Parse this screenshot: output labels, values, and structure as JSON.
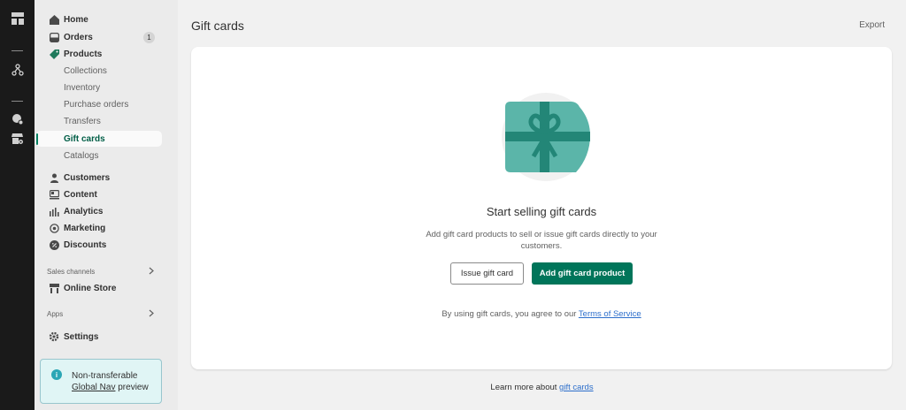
{
  "rail": {
    "icons": [
      "layout-icon",
      "branch-icon",
      "globe-gear-icon",
      "store-gear-icon"
    ]
  },
  "sidebar": {
    "items": [
      {
        "label": "Home",
        "icon": "home-icon"
      },
      {
        "label": "Orders",
        "icon": "orders-icon",
        "badge": "1"
      },
      {
        "label": "Products",
        "icon": "tag-icon"
      }
    ],
    "product_subitems": [
      "Collections",
      "Inventory",
      "Purchase orders",
      "Transfers",
      "Gift cards",
      "Catalogs"
    ],
    "active_subitem": "Gift cards",
    "more_items": [
      {
        "label": "Customers",
        "icon": "person-icon"
      },
      {
        "label": "Content",
        "icon": "content-icon"
      },
      {
        "label": "Analytics",
        "icon": "bar-chart-icon"
      },
      {
        "label": "Marketing",
        "icon": "target-icon"
      },
      {
        "label": "Discounts",
        "icon": "discount-icon"
      }
    ],
    "sales_channels_label": "Sales channels",
    "online_store_label": "Online Store",
    "apps_label": "Apps",
    "settings_label": "Settings",
    "preview": {
      "line1": "Non-transferable",
      "link": "Global Nav",
      "line2_rest": " preview"
    }
  },
  "main": {
    "title": "Gift cards",
    "export_label": "Export",
    "empty_state": {
      "heading": "Start selling gift cards",
      "description": "Add gift card products to sell or issue gift cards directly to your customers.",
      "secondary_button": "Issue gift card",
      "primary_button": "Add gift card product",
      "terms_prefix": "By using gift cards, you agree to our ",
      "terms_link": "Terms of Service"
    },
    "footer": {
      "prefix": "Learn more about ",
      "link": "gift cards"
    }
  },
  "colors": {
    "primary": "#00755a",
    "active_text": "#005e46",
    "link": "#2c6ecb",
    "gift_card": "#5bb5a9",
    "ribbon": "#238677"
  }
}
